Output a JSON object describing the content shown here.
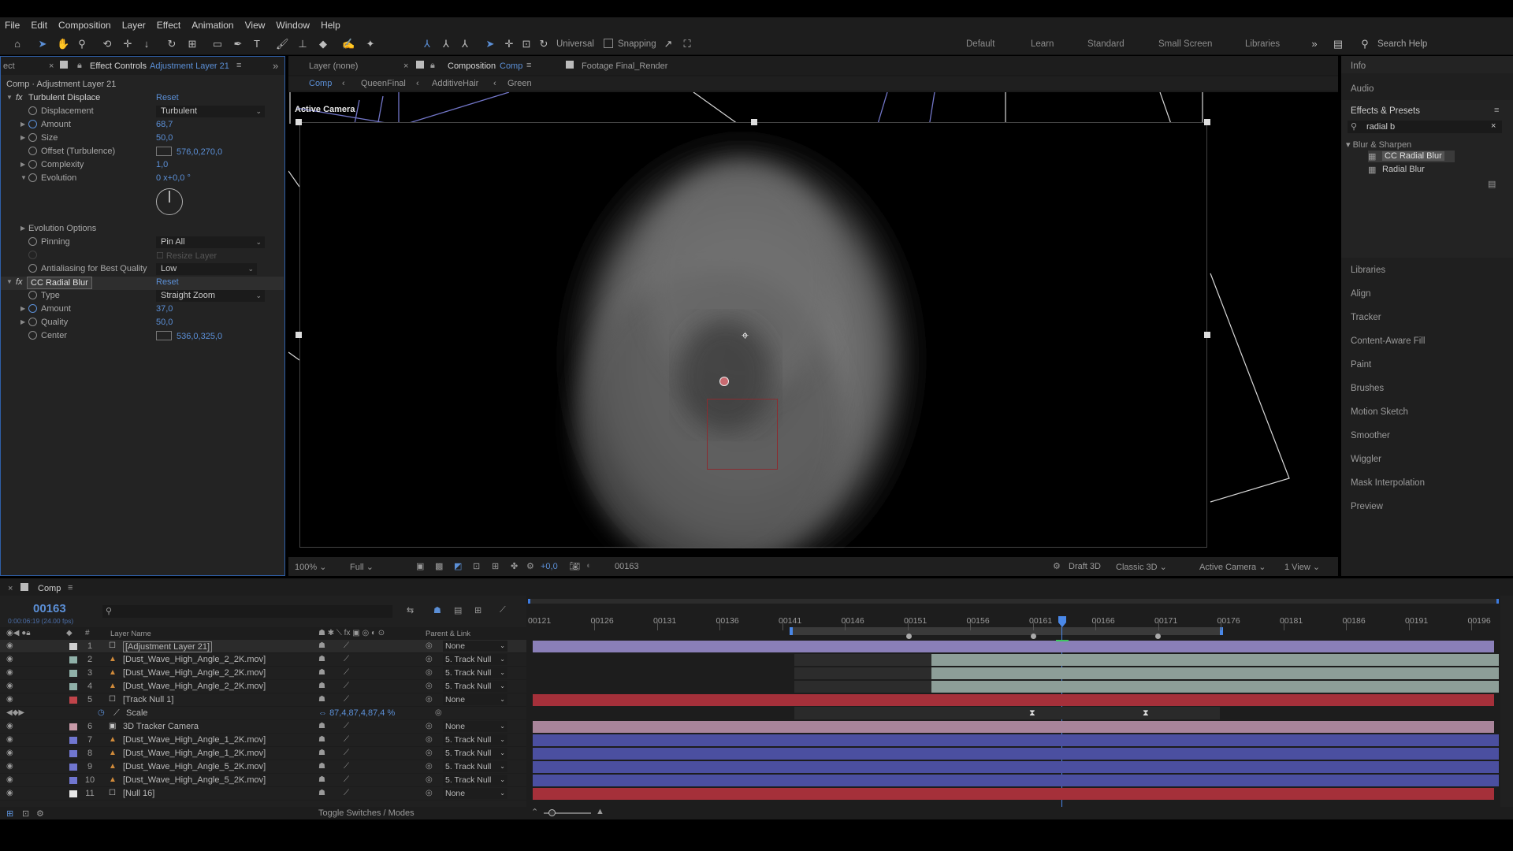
{
  "menu": [
    "File",
    "Edit",
    "Composition",
    "Layer",
    "Effect",
    "Animation",
    "View",
    "Window",
    "Help"
  ],
  "toolbar": {
    "universal": "Universal",
    "snapping": "Snapping"
  },
  "workspaces": [
    "Default",
    "Learn",
    "Standard",
    "Small Screen",
    "Libraries"
  ],
  "search_help": "Search Help",
  "effect_controls": {
    "tab_prefix": "ect",
    "tab_label": "Effect Controls",
    "tab_layer": "Adjustment Layer 21",
    "header": "Comp · Adjustment Layer 21",
    "reset": "Reset",
    "turbulent_displace": "Turbulent Displace",
    "rows": [
      {
        "name": "Displacement",
        "dropdown": "Turbulent"
      },
      {
        "name": "Amount",
        "value": "68,7"
      },
      {
        "name": "Size",
        "value": "50,0"
      },
      {
        "name": "Offset (Turbulence)",
        "value": "576,0,270,0"
      },
      {
        "name": "Complexity",
        "value": "1,0"
      },
      {
        "name": "Evolution",
        "value": "0 x+0,0 °"
      }
    ],
    "evolution_options": "Evolution Options",
    "pinning": {
      "name": "Pinning",
      "dropdown": "Pin All"
    },
    "resize_layer": "Resize Layer",
    "antialiasing": {
      "name": "Antialiasing for Best Quality",
      "dropdown": "Low"
    },
    "cc_radial_blur": "CC Radial Blur",
    "blur_rows": [
      {
        "name": "Type",
        "dropdown": "Straight Zoom"
      },
      {
        "name": "Amount",
        "value": "37,0"
      },
      {
        "name": "Quality",
        "value": "50,0"
      },
      {
        "name": "Center",
        "value": "536,0,325,0"
      }
    ]
  },
  "viewer": {
    "tab_layer": "Layer (none)",
    "tab_comp_label": "Composition",
    "tab_comp_name": "Comp",
    "tab_footage": "Footage Final_Render",
    "breadcrumbs": [
      "Comp",
      "QueenFinal",
      "AdditiveHair",
      "Green"
    ],
    "active_camera_label": "Active Camera",
    "zoom": "100%",
    "resolution": "Full",
    "exposure": "+0,0",
    "frame": "00163",
    "renderer": "Draft 3D",
    "renderer_mode": "Classic 3D",
    "camera": "Active Camera",
    "view": "1 View"
  },
  "right_panel": {
    "items_top": [
      "Info",
      "Audio"
    ],
    "effects_presets": "Effects & Presets",
    "search_value": "radial b",
    "category": "Blur & Sharpen",
    "results": [
      "CC Radial Blur",
      "Radial Blur"
    ],
    "items": [
      "Libraries",
      "Align",
      "Tracker",
      "Content-Aware Fill",
      "Paint",
      "Brushes",
      "Motion Sketch",
      "Smoother",
      "Wiggler",
      "Mask Interpolation",
      "Preview"
    ]
  },
  "timeline": {
    "tab": "Comp",
    "current_frame": "00163",
    "timecode_sub": "0:00:06:19 (24.00 fps)",
    "col_layer_name": "Layer Name",
    "col_parent": "Parent & Link",
    "ticks": [
      "00121",
      "00126",
      "00131",
      "00136",
      "00141",
      "00146",
      "00151",
      "00156",
      "00161",
      "00166",
      "00171",
      "00176",
      "00181",
      "00186",
      "00191",
      "00196"
    ],
    "layers": [
      {
        "num": "1",
        "name": "[Adjustment Layer 21]",
        "parent": "None",
        "label": "#d0d0d0"
      },
      {
        "num": "2",
        "name": "[Dust_Wave_High_Angle_2_2K.mov]",
        "parent": "5. Track Null",
        "label": "#8fb0a8"
      },
      {
        "num": "3",
        "name": "[Dust_Wave_High_Angle_2_2K.mov]",
        "parent": "5. Track Null",
        "label": "#8fb0a8"
      },
      {
        "num": "4",
        "name": "[Dust_Wave_High_Angle_2_2K.mov]",
        "parent": "5. Track Null",
        "label": "#8fb0a8"
      },
      {
        "num": "5",
        "name": "[Track Null 1]",
        "parent": "None",
        "label": "#c0444a"
      },
      {
        "num": "6",
        "name": "3D Tracker Camera",
        "parent": "None",
        "label": "#c79aa8"
      },
      {
        "num": "7",
        "name": "[Dust_Wave_High_Angle_1_2K.mov]",
        "parent": "5. Track Null",
        "label": "#7076d0"
      },
      {
        "num": "8",
        "name": "[Dust_Wave_High_Angle_1_2K.mov]",
        "parent": "5. Track Null",
        "label": "#7076d0"
      },
      {
        "num": "9",
        "name": "[Dust_Wave_High_Angle_5_2K.mov]",
        "parent": "5. Track Null",
        "label": "#7076d0"
      },
      {
        "num": "10",
        "name": "[Dust_Wave_High_Angle_5_2K.mov]",
        "parent": "5. Track Null",
        "label": "#7076d0"
      },
      {
        "num": "11",
        "name": "[Null 16]",
        "parent": "None",
        "label": "#e8e8e8"
      }
    ],
    "scale_label": "Scale",
    "scale_value": "87,4,87,4,87,4 %",
    "toggle": "Toggle Switches / Modes"
  }
}
